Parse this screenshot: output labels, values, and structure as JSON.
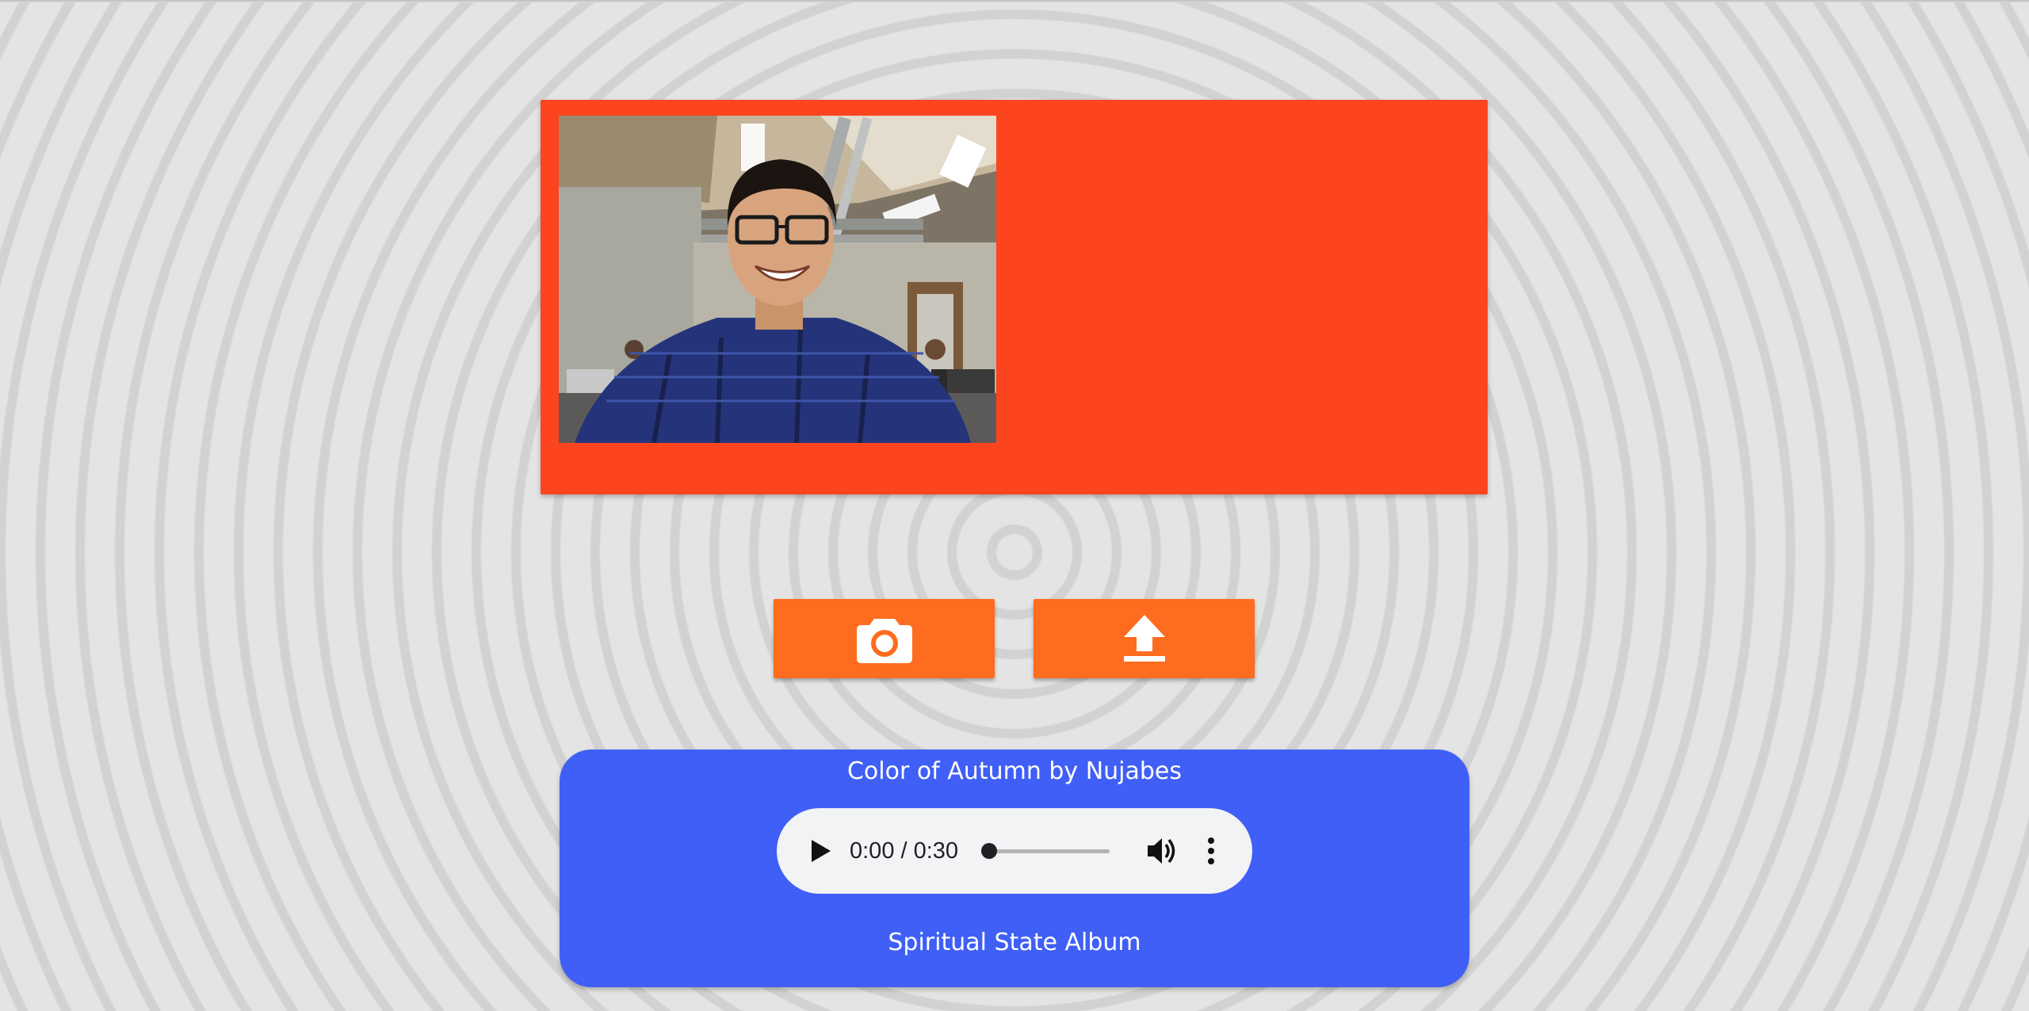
{
  "camera": {
    "icon_name": "webcam-feed",
    "panel_color": "#fc441f"
  },
  "buttons": {
    "capture_icon": "camera-icon",
    "upload_icon": "upload-icon",
    "color": "#fd6c1f"
  },
  "music": {
    "song": "Color of Autumn by Nujabes",
    "album": "Spiritual State Album",
    "card_color": "#3f5ff6",
    "player": {
      "time": "0:00 / 0:30",
      "progress": 0
    }
  }
}
